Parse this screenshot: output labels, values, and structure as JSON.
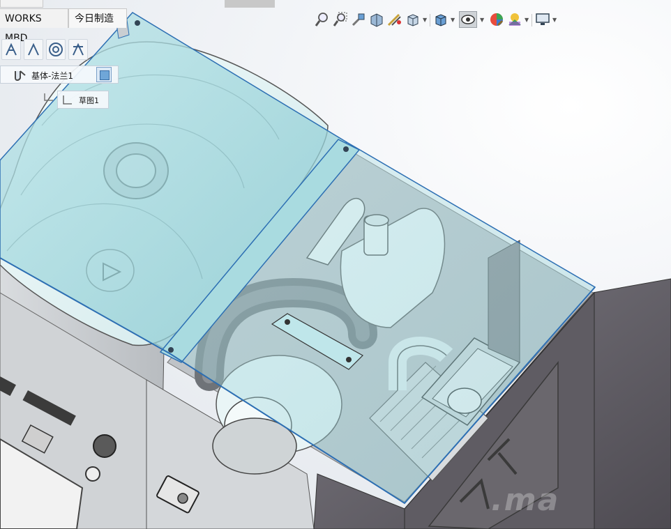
{
  "tabs": [
    {
      "label": "WORKS MBD"
    },
    {
      "label": "今日制造"
    }
  ],
  "feature_tree": {
    "feature_label": "基体-法兰1",
    "sketch_label": "草图1"
  },
  "view_toolbar": {
    "buttons": [
      {
        "icon": "zoom-to-fit-icon"
      },
      {
        "icon": "zoom-to-area-icon"
      },
      {
        "icon": "previous-view-icon"
      },
      {
        "icon": "section-view-icon"
      },
      {
        "icon": "dynamic-annotation-views-icon"
      },
      {
        "icon": "view-orientation-icon"
      },
      {
        "icon": "display-style-icon"
      },
      {
        "icon": "hide-show-items-icon"
      },
      {
        "icon": "edit-appearance-icon"
      },
      {
        "icon": "apply-scene-icon"
      },
      {
        "icon": "view-settings-icon"
      }
    ]
  },
  "sketch_toolbar": {
    "buttons": [
      {
        "icon": "smart-dimension-icon"
      },
      {
        "icon": "line-icon"
      },
      {
        "icon": "circle-icon"
      },
      {
        "icon": "sketch-fillet-icon"
      }
    ]
  },
  "watermark": {
    "text": ".ma"
  },
  "colors": {
    "glass_panel": "#9fd6dc",
    "frame_edge": "#2d6fb3",
    "housing_dark": "#6d6a72",
    "background_light": "#ffffff"
  }
}
